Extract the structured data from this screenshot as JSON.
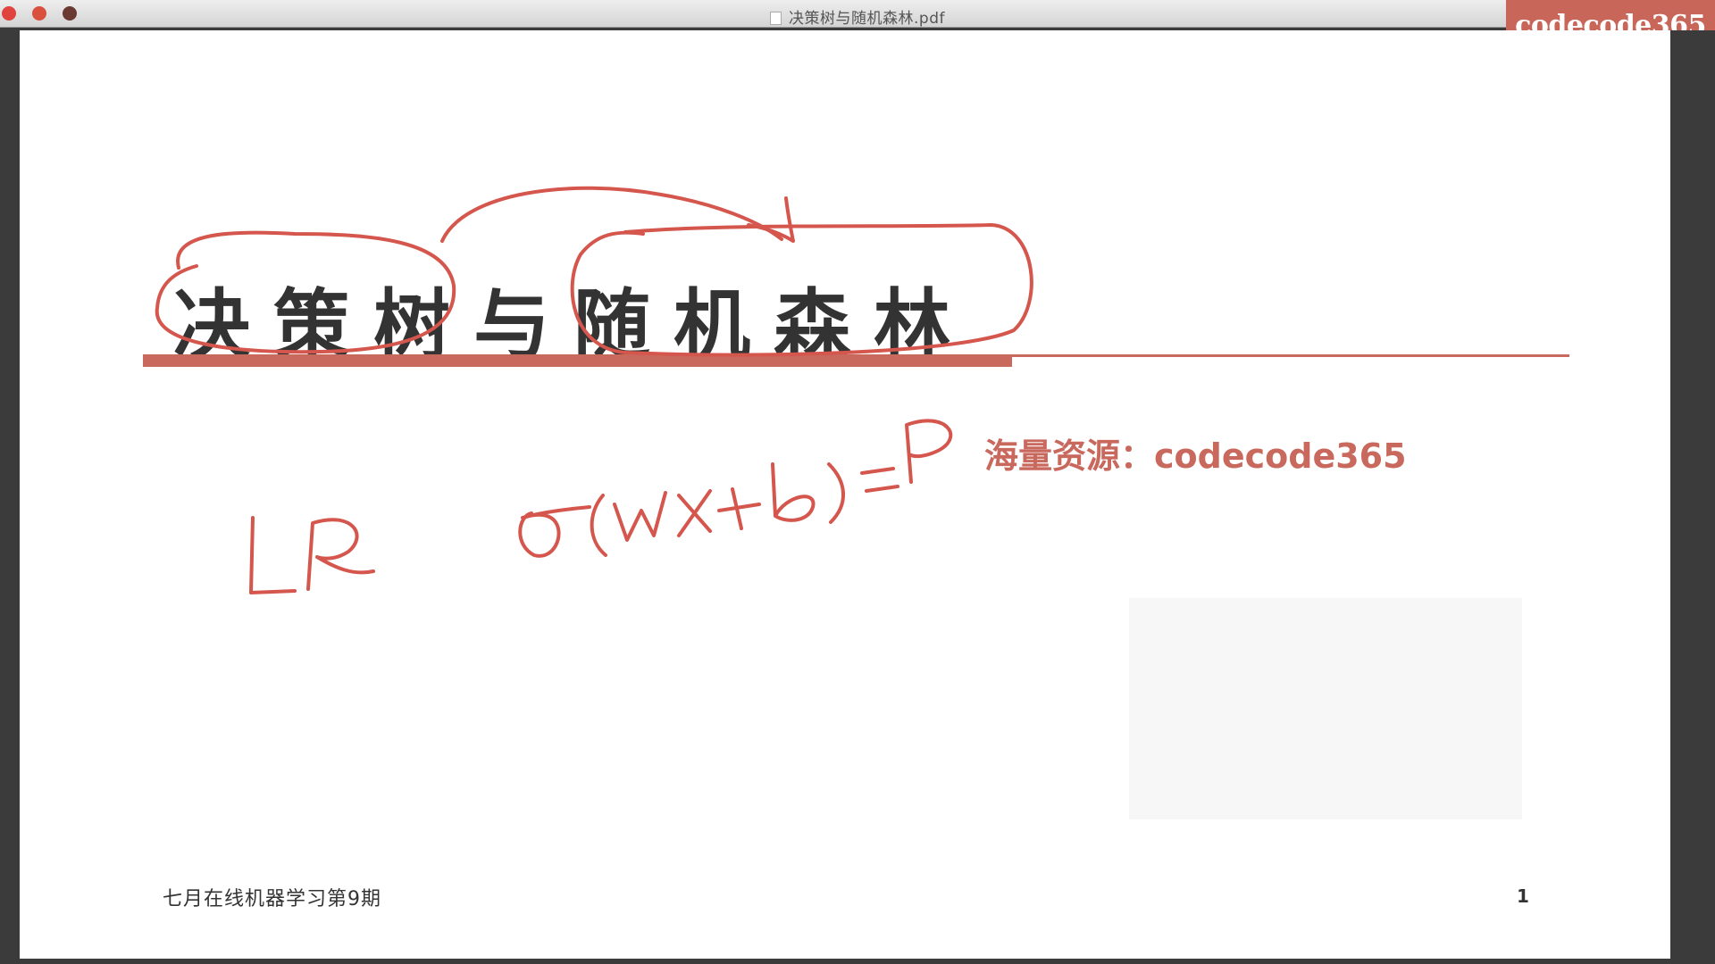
{
  "window": {
    "title": "决策树与随机森林.pdf",
    "icon": "pdf-document-icon"
  },
  "watermark": {
    "label": "codecode365"
  },
  "slide": {
    "title": "决策树与随机森林",
    "resource_note": "海量资源：codecode365",
    "footer_text": "七月在线机器学习第9期",
    "page_number": "1"
  },
  "colors": {
    "accent": "#c9695e",
    "ink": "#d4564d",
    "watermark_bg": "#c9665a"
  }
}
